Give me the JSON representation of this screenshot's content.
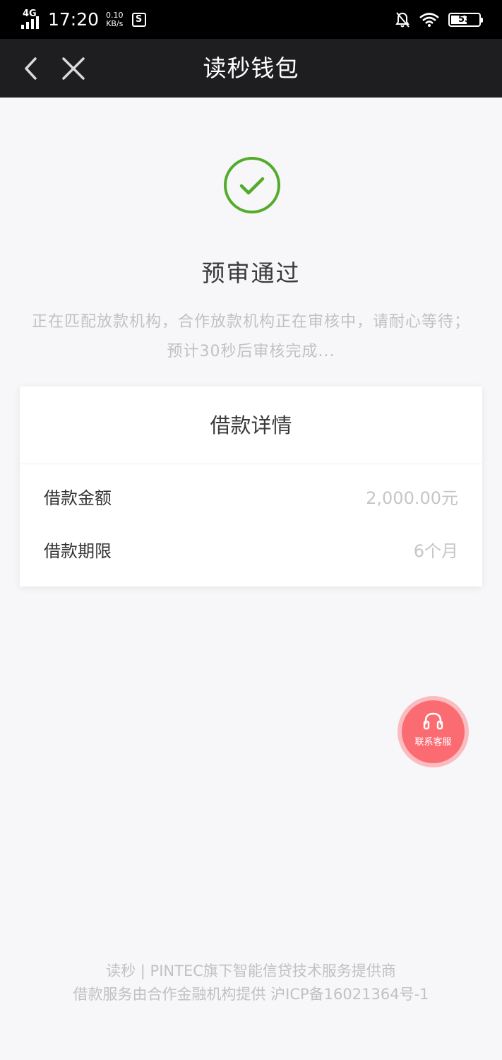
{
  "status_bar": {
    "network": "4G",
    "time": "17:20",
    "speed_value": "0.10",
    "speed_unit": "KB/s",
    "sim_icon_text": "S",
    "battery": "53",
    "icons": [
      "signal-icon",
      "sim-icon",
      "mute-bell-icon",
      "wifi-icon",
      "battery-icon"
    ]
  },
  "nav": {
    "title": "读秒钱包",
    "back_icon": "chevron-left-icon",
    "close_icon": "close-icon"
  },
  "result": {
    "icon": "check-circle-icon",
    "title": "预审通过",
    "description": "正在匹配放款机构，合作放款机构正在审核中，请耐心等待；预计30秒后审核完成...",
    "accent_color": "#52ac2a"
  },
  "loan_card": {
    "title": "借款详情",
    "rows": [
      {
        "label": "借款金额",
        "value": "2,000.00元"
      },
      {
        "label": "借款期限",
        "value": "6个月"
      }
    ]
  },
  "service": {
    "icon": "headset-icon",
    "label": "联系客服",
    "color": "#fb6c72"
  },
  "footer": {
    "line1": "读秒 | PINTEC旗下智能信贷技术服务提供商",
    "line2": "借款服务由合作金融机构提供 沪ICP备16021364号-1"
  }
}
